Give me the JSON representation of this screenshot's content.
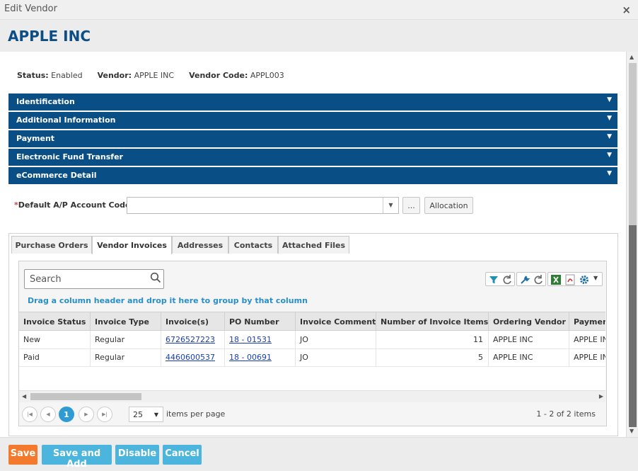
{
  "window": {
    "title": "Edit Vendor",
    "close_symbol": "×"
  },
  "vendor_name": "APPLE INC",
  "status_line": {
    "status_label": "Status:",
    "status_value": "Enabled",
    "vendor_label": "Vendor:",
    "vendor_value": "APPLE INC",
    "code_label": "Vendor Code:",
    "code_value": "APPL003"
  },
  "panels": [
    "Identification",
    "Additional Information",
    "Payment",
    "Electronic Fund Transfer",
    "eCommerce Detail"
  ],
  "default_account": {
    "required_mark": "*",
    "label": "Default A/P Account Code:",
    "value": "",
    "ellipsis_label": "...",
    "allocation_label": "Allocation"
  },
  "tabs": [
    "Purchase Orders",
    "Vendor Invoices",
    "Addresses",
    "Contacts",
    "Attached Files"
  ],
  "active_tab": "Vendor Invoices",
  "grid": {
    "search_placeholder": "Search",
    "group_hint": "Drag a column header and drop it here to group by that column",
    "columns": [
      "Invoice Status",
      "Invoice Type",
      "Invoice(s)",
      "PO Number",
      "Invoice Comment",
      "Number of Invoice Items",
      "Ordering Vendor",
      "Payment"
    ],
    "rows": [
      [
        "New",
        "Regular",
        "6726527223",
        "18 - 01531",
        "JO",
        "11",
        "APPLE INC",
        "APPLE INC"
      ],
      [
        "Paid",
        "Regular",
        "4460600537",
        "18 - 00691",
        "JO",
        "5",
        "APPLE INC",
        "APPLE INC"
      ]
    ],
    "pager": {
      "current_page": "1",
      "page_size": "25",
      "items_per_page_label": "items per page",
      "summary": "1 - 2 of 2 items"
    }
  },
  "footer_buttons": {
    "save": "Save",
    "save_and_add": "Save and Add",
    "disable": "Disable",
    "cancel": "Cancel"
  },
  "colors": {
    "panel_bg": "#0a4e86",
    "title_color": "#0d4e85",
    "save_button": "#f37a2c",
    "action_button": "#4bb5dd",
    "link": "#1a3fb3",
    "hint": "#2a8fc4"
  }
}
